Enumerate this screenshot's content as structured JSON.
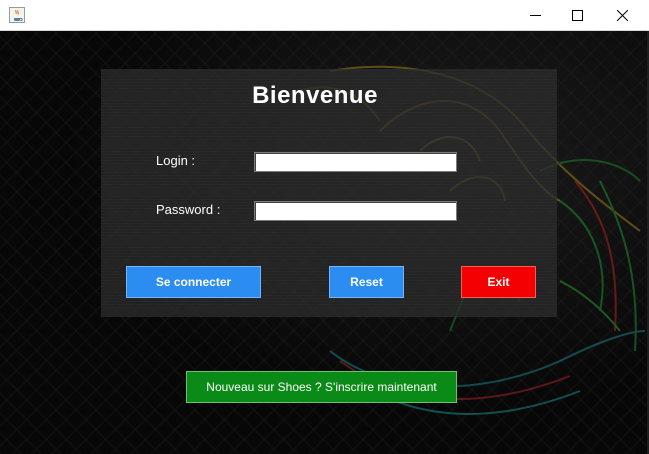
{
  "window": {
    "app_icon": "java-cup-icon",
    "controls": {
      "minimize": "minimize-icon",
      "maximize": "maximize-icon",
      "close": "close-icon"
    }
  },
  "form": {
    "title": "Bienvenue",
    "login_label": "Login :",
    "login_value": "",
    "password_label": "Password :",
    "password_value": ""
  },
  "buttons": {
    "connect": "Se connecter",
    "reset": "Reset",
    "exit": "Exit",
    "signup": "Nouveau sur Shoes ? S'inscrire maintenant"
  },
  "colors": {
    "primary_button": "#2b8cf2",
    "exit_button": "#f50000",
    "signup_button": "#0a8a16",
    "panel": "#2a2a2a"
  }
}
